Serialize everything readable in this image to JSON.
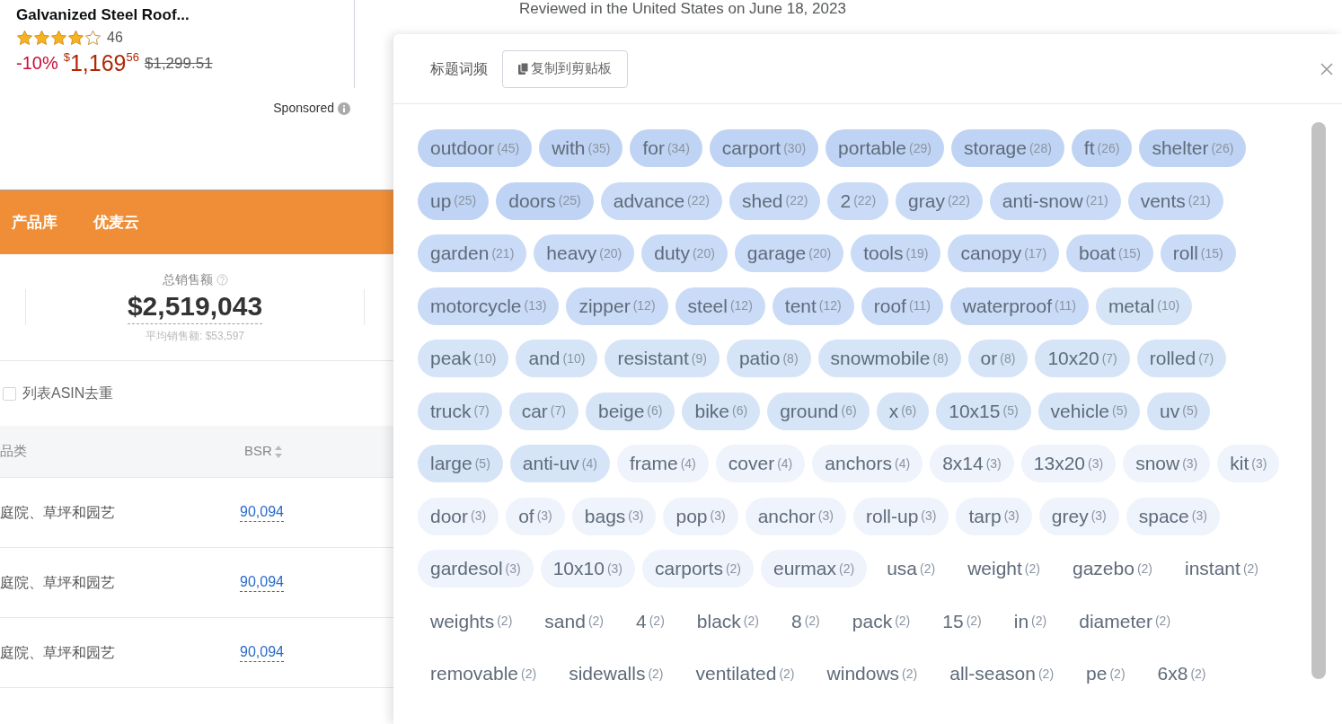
{
  "product": {
    "title": "Galvanized Steel Roof...",
    "stars": 4,
    "review_count": "46",
    "discount": "-10%",
    "currency": "$",
    "price_whole": "1,169",
    "price_fraction": "56",
    "list_price": "$1,299.51",
    "sponsored": "Sponsored"
  },
  "review": {
    "date": "Reviewed in the United States on June 18, 2023"
  },
  "nav": {
    "items": [
      {
        "label": "产品库"
      },
      {
        "label": "优麦云"
      }
    ]
  },
  "stats": {
    "label": "总销售额",
    "value": "$2,519,043",
    "average": "平均销售额: $53,597"
  },
  "dedupe": {
    "label": "列表ASIN去重",
    "checked": false
  },
  "table": {
    "columns": [
      "品类",
      "BSR"
    ],
    "rows": [
      [
        "庭院、草坪和园艺",
        "90,094"
      ],
      [
        "庭院、草坪和园艺",
        "90,094"
      ],
      [
        "庭院、草坪和园艺",
        "90,094"
      ]
    ]
  },
  "panel": {
    "title": "标题词频",
    "copy_button": "复制到剪贴板",
    "tags": [
      {
        "word": "outdoor",
        "count": "(45)",
        "color": "#bfd4f4"
      },
      {
        "word": "with",
        "count": "(35)",
        "color": "#bfd4f4"
      },
      {
        "word": "for",
        "count": "(34)",
        "color": "#bfd4f4"
      },
      {
        "word": "carport",
        "count": "(30)",
        "color": "#bfd4f4"
      },
      {
        "word": "portable",
        "count": "(29)",
        "color": "#bfd4f4"
      },
      {
        "word": "storage",
        "count": "(28)",
        "color": "#bfd4f4"
      },
      {
        "word": "ft",
        "count": "(26)",
        "color": "#bfd4f4"
      },
      {
        "word": "shelter",
        "count": "(26)",
        "color": "#bfd4f4"
      },
      {
        "word": "up",
        "count": "(25)",
        "color": "#bfd4f4"
      },
      {
        "word": "doors",
        "count": "(25)",
        "color": "#bfd4f4"
      },
      {
        "word": "advance",
        "count": "(22)",
        "color": "#c9dbf6"
      },
      {
        "word": "shed",
        "count": "(22)",
        "color": "#c9dbf6"
      },
      {
        "word": "2",
        "count": "(22)",
        "color": "#c9dbf6"
      },
      {
        "word": "gray",
        "count": "(22)",
        "color": "#c9dbf6"
      },
      {
        "word": "anti-snow",
        "count": "(21)",
        "color": "#c9dbf6"
      },
      {
        "word": "vents",
        "count": "(21)",
        "color": "#c9dbf6"
      },
      {
        "word": "garden",
        "count": "(21)",
        "color": "#c9dbf6"
      },
      {
        "word": "heavy",
        "count": "(20)",
        "color": "#c9dbf6"
      },
      {
        "word": "duty",
        "count": "(20)",
        "color": "#c9dbf6"
      },
      {
        "word": "garage",
        "count": "(20)",
        "color": "#c9dbf6"
      },
      {
        "word": "tools",
        "count": "(19)",
        "color": "#c9dbf6"
      },
      {
        "word": "canopy",
        "count": "(17)",
        "color": "#c9dbf6"
      },
      {
        "word": "boat",
        "count": "(15)",
        "color": "#c9dbf6"
      },
      {
        "word": "roll",
        "count": "(15)",
        "color": "#c9dbf6"
      },
      {
        "word": "motorcycle",
        "count": "(13)",
        "color": "#c9dbf6"
      },
      {
        "word": "zipper",
        "count": "(12)",
        "color": "#c9dbf6"
      },
      {
        "word": "steel",
        "count": "(12)",
        "color": "#c9dbf6"
      },
      {
        "word": "tent",
        "count": "(12)",
        "color": "#c9dbf6"
      },
      {
        "word": "roof",
        "count": "(11)",
        "color": "#c9dbf6"
      },
      {
        "word": "waterproof",
        "count": "(11)",
        "color": "#c9dbf6"
      },
      {
        "word": "metal",
        "count": "(10)",
        "color": "#d6e4f8"
      },
      {
        "word": "peak",
        "count": "(10)",
        "color": "#d6e4f8"
      },
      {
        "word": "and",
        "count": "(10)",
        "color": "#d6e4f8"
      },
      {
        "word": "resistant",
        "count": "(9)",
        "color": "#d6e4f8"
      },
      {
        "word": "patio",
        "count": "(8)",
        "color": "#d6e4f8"
      },
      {
        "word": "snowmobile",
        "count": "(8)",
        "color": "#d6e4f8"
      },
      {
        "word": "or",
        "count": "(8)",
        "color": "#d6e4f8"
      },
      {
        "word": "10x20",
        "count": "(7)",
        "color": "#d6e4f8"
      },
      {
        "word": "rolled",
        "count": "(7)",
        "color": "#d6e4f8"
      },
      {
        "word": "truck",
        "count": "(7)",
        "color": "#d6e4f8"
      },
      {
        "word": "car",
        "count": "(7)",
        "color": "#d6e4f8"
      },
      {
        "word": "beige",
        "count": "(6)",
        "color": "#d6e4f8"
      },
      {
        "word": "bike",
        "count": "(6)",
        "color": "#d6e4f8"
      },
      {
        "word": "ground",
        "count": "(6)",
        "color": "#d6e4f8"
      },
      {
        "word": "x",
        "count": "(6)",
        "color": "#d6e4f8"
      },
      {
        "word": "10x15",
        "count": "(5)",
        "color": "#d6e4f8"
      },
      {
        "word": "vehicle",
        "count": "(5)",
        "color": "#d6e4f8"
      },
      {
        "word": "uv",
        "count": "(5)",
        "color": "#d6e4f8"
      },
      {
        "word": "large",
        "count": "(5)",
        "color": "#d6e4f8"
      },
      {
        "word": "anti-uv",
        "count": "(4)",
        "color": "#d6e4f8"
      },
      {
        "word": "frame",
        "count": "(4)",
        "color": "#eef3fc"
      },
      {
        "word": "cover",
        "count": "(4)",
        "color": "#eef3fc"
      },
      {
        "word": "anchors",
        "count": "(4)",
        "color": "#eef3fc"
      },
      {
        "word": "8x14",
        "count": "(3)",
        "color": "#eef3fc"
      },
      {
        "word": "13x20",
        "count": "(3)",
        "color": "#eef3fc"
      },
      {
        "word": "snow",
        "count": "(3)",
        "color": "#eef3fc"
      },
      {
        "word": "kit",
        "count": "(3)",
        "color": "#eef3fc"
      },
      {
        "word": "door",
        "count": "(3)",
        "color": "#eef3fc"
      },
      {
        "word": "of",
        "count": "(3)",
        "color": "#eef3fc"
      },
      {
        "word": "bags",
        "count": "(3)",
        "color": "#eef3fc"
      },
      {
        "word": "pop",
        "count": "(3)",
        "color": "#eef3fc"
      },
      {
        "word": "anchor",
        "count": "(3)",
        "color": "#eef3fc"
      },
      {
        "word": "roll-up",
        "count": "(3)",
        "color": "#eef3fc"
      },
      {
        "word": "tarp",
        "count": "(3)",
        "color": "#eef3fc"
      },
      {
        "word": "grey",
        "count": "(3)",
        "color": "#eef3fc"
      },
      {
        "word": "space",
        "count": "(3)",
        "color": "#eef3fc"
      },
      {
        "word": "gardesol",
        "count": "(3)",
        "color": "#eef3fc"
      },
      {
        "word": "10x10",
        "count": "(3)",
        "color": "#eef3fc"
      },
      {
        "word": "carports",
        "count": "(2)",
        "color": "#eef3fc"
      },
      {
        "word": "eurmax",
        "count": "(2)",
        "color": "#eef3fc"
      },
      {
        "word": "usa",
        "count": "(2)",
        "color": "#ffffff"
      },
      {
        "word": "weight",
        "count": "(2)",
        "color": "#ffffff"
      },
      {
        "word": "gazebo",
        "count": "(2)",
        "color": "#ffffff"
      },
      {
        "word": "instant",
        "count": "(2)",
        "color": "#ffffff"
      },
      {
        "word": "weights",
        "count": "(2)",
        "color": "#ffffff"
      },
      {
        "word": "sand",
        "count": "(2)",
        "color": "#ffffff"
      },
      {
        "word": "4",
        "count": "(2)",
        "color": "#ffffff"
      },
      {
        "word": "black",
        "count": "(2)",
        "color": "#ffffff"
      },
      {
        "word": "8",
        "count": "(2)",
        "color": "#ffffff"
      },
      {
        "word": "pack",
        "count": "(2)",
        "color": "#ffffff"
      },
      {
        "word": "15",
        "count": "(2)",
        "color": "#ffffff"
      },
      {
        "word": "in",
        "count": "(2)",
        "color": "#ffffff"
      },
      {
        "word": "diameter",
        "count": "(2)",
        "color": "#ffffff"
      },
      {
        "word": "removable",
        "count": "(2)",
        "color": "#ffffff"
      },
      {
        "word": "sidewalls",
        "count": "(2)",
        "color": "#ffffff"
      },
      {
        "word": "ventilated",
        "count": "(2)",
        "color": "#ffffff"
      },
      {
        "word": "windows",
        "count": "(2)",
        "color": "#ffffff"
      },
      {
        "word": "all-season",
        "count": "(2)",
        "color": "#ffffff"
      },
      {
        "word": "pe",
        "count": "(2)",
        "color": "#ffffff"
      },
      {
        "word": "6x8",
        "count": "(2)",
        "color": "#ffffff"
      }
    ]
  }
}
